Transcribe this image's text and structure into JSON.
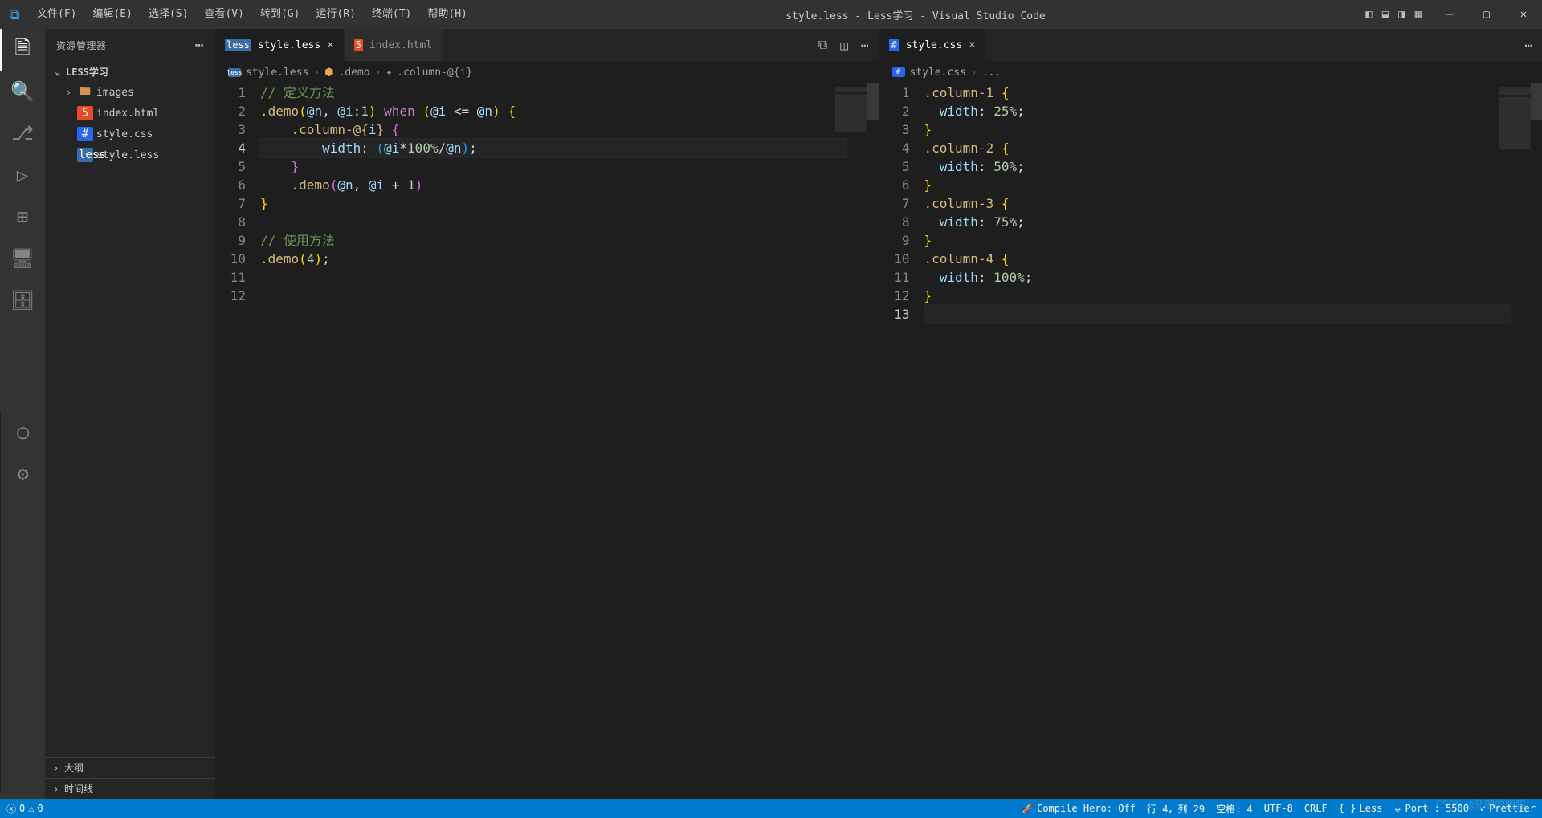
{
  "menu": [
    "文件(F)",
    "编辑(E)",
    "选择(S)",
    "查看(V)",
    "转到(G)",
    "运行(R)",
    "终端(T)",
    "帮助(H)"
  ],
  "window_title": "style.less - Less学习 - Visual Studio Code",
  "sidebar": {
    "title": "资源管理器",
    "project": "LESS学习",
    "items": [
      {
        "type": "folder",
        "label": "images",
        "indent": 1
      },
      {
        "type": "file",
        "label": "index.html",
        "icon": "html",
        "indent": 1
      },
      {
        "type": "file",
        "label": "style.css",
        "icon": "css",
        "indent": 1
      },
      {
        "type": "file",
        "label": "style.less",
        "icon": "less",
        "indent": 1
      }
    ],
    "outline": "大纲",
    "timeline": "时间线"
  },
  "group1": {
    "tabs": [
      {
        "icon": "less",
        "label": "style.less",
        "active": true,
        "close": true
      },
      {
        "icon": "html",
        "label": "index.html",
        "active": false,
        "close": false
      }
    ],
    "breadcrumb": {
      "file": "style.less",
      "sym1": ".demo",
      "sym2": ".column-@{i}"
    },
    "cursor_line": 4,
    "lines": [
      {
        "n": 1,
        "html": "<span class='tok-comment'>// 定义方法</span>"
      },
      {
        "n": 2,
        "html": "<span class='tok-sel'>.demo</span><span class='tok-paren'>(</span><span class='tok-var'>@n</span>, <span class='tok-var'>@i</span>:<span class='tok-num'>1</span><span class='tok-paren'>)</span> <span class='tok-kw'>when</span> <span class='tok-paren'>(</span><span class='tok-var'>@i</span> <span class='tok-op'>&lt;=</span> <span class='tok-var'>@n</span><span class='tok-paren'>)</span> <span class='tok-paren'>{</span>"
      },
      {
        "n": 3,
        "html": "    <span class='tok-sel'>.column-@{</span><span class='tok-var'>i</span><span class='tok-sel'>}</span> <span class='tok-paren2'>{</span>"
      },
      {
        "n": 4,
        "html": "        <span class='tok-prop'>width</span>: <span class='tok-paren3'>(</span><span class='tok-var'>@i</span><span class='tok-op'>*</span><span class='tok-num'>100%</span><span class='tok-op'>/</span><span class='tok-var'>@n</span><span class='tok-paren3'>)</span>;"
      },
      {
        "n": 5,
        "html": "    <span class='tok-paren2'>}</span>"
      },
      {
        "n": 6,
        "html": "    <span class='tok-sel'>.demo</span><span class='tok-paren2'>(</span><span class='tok-var'>@n</span>, <span class='tok-var'>@i</span> <span class='tok-op'>+</span> <span class='tok-num'>1</span><span class='tok-paren2'>)</span>"
      },
      {
        "n": 7,
        "html": "<span class='tok-paren'>}</span>"
      },
      {
        "n": 8,
        "html": ""
      },
      {
        "n": 9,
        "html": "<span class='tok-comment'>// 使用方法</span>"
      },
      {
        "n": 10,
        "html": "<span class='tok-sel'>.demo</span><span class='tok-paren'>(</span><span class='tok-num'>4</span><span class='tok-paren'>)</span>;"
      },
      {
        "n": 11,
        "html": ""
      },
      {
        "n": 12,
        "html": ""
      }
    ]
  },
  "group2": {
    "tabs": [
      {
        "icon": "css",
        "label": "style.css",
        "active": true,
        "close": true
      }
    ],
    "breadcrumb": {
      "file": "style.css",
      "rest": "..."
    },
    "cursor_line": 13,
    "lines": [
      {
        "n": 1,
        "html": "<span class='tok-sel'>.column-1</span> <span class='tok-paren'>{</span>"
      },
      {
        "n": 2,
        "html": "  <span class='tok-prop'>width</span>: <span class='tok-num'>25%</span>;"
      },
      {
        "n": 3,
        "html": "<span class='tok-paren'>}</span>"
      },
      {
        "n": 4,
        "html": "<span class='tok-sel'>.column-2</span> <span class='tok-paren'>{</span>"
      },
      {
        "n": 5,
        "html": "  <span class='tok-prop'>width</span>: <span class='tok-num'>50%</span>;"
      },
      {
        "n": 6,
        "html": "<span class='tok-paren'>}</span>"
      },
      {
        "n": 7,
        "html": "<span class='tok-sel'>.column-3</span> <span class='tok-paren'>{</span>"
      },
      {
        "n": 8,
        "html": "  <span class='tok-prop'>width</span>: <span class='tok-num'>75%</span>;"
      },
      {
        "n": 9,
        "html": "<span class='tok-paren'>}</span>"
      },
      {
        "n": 10,
        "html": "<span class='tok-sel'>.column-4</span> <span class='tok-paren'>{</span>"
      },
      {
        "n": 11,
        "html": "  <span class='tok-prop'>width</span>: <span class='tok-num'>100%</span>;"
      },
      {
        "n": 12,
        "html": "<span class='tok-paren'>}</span>"
      },
      {
        "n": 13,
        "html": ""
      }
    ]
  },
  "status": {
    "errors": "0",
    "warnings": "0",
    "compile": "Compile Hero: Off",
    "pos": "行 4，列 29",
    "spaces": "空格: 4",
    "encoding": "UTF-8",
    "eol": "CRLF",
    "lang": "Less",
    "port": "Port : 5500",
    "prettier": "Prettier"
  },
  "watermark": "CSDN @邻家的肥猫"
}
